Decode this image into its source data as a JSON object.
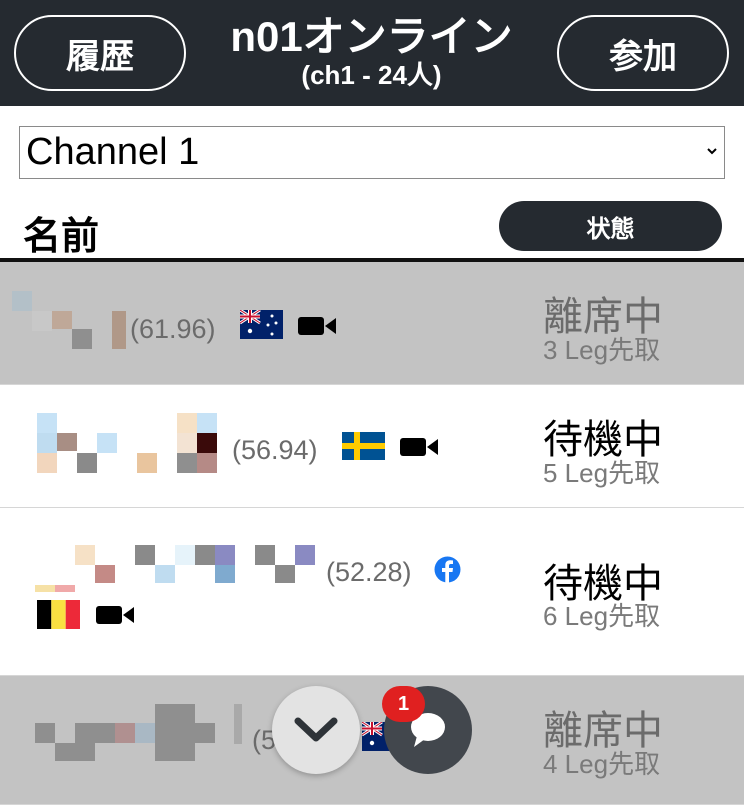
{
  "header": {
    "history_label": "履歴",
    "title": "n01オンライン",
    "subtitle": "(ch1 - 24人)",
    "join_label": "参加"
  },
  "channel_select": {
    "value": "Channel 1"
  },
  "columns": {
    "name": "名前",
    "status": "状態"
  },
  "rows": [
    {
      "rating": "(61.96)",
      "flag": "australia-flag",
      "status": "離席中",
      "leg": "3 Leg先取",
      "state": "away"
    },
    {
      "rating": "(56.94)",
      "flag": "sweden-flag",
      "status": "待機中",
      "leg": "5 Leg先取",
      "state": "waiting"
    },
    {
      "rating": "(52.28)",
      "flag": "belgium-flag",
      "status": "待機中",
      "leg": "6 Leg先取",
      "state": "waiting"
    },
    {
      "rating": "(50.50)",
      "flag": "australia-flag",
      "status": "離席中",
      "leg": "4 Leg先取",
      "state": "away"
    }
  ],
  "chat": {
    "badge_count": "1"
  },
  "colors": {
    "header_bg": "#252a30",
    "away_row_bg": "#c3c3c3",
    "badge_red": "#e02020",
    "facebook_blue": "#1877f2"
  }
}
